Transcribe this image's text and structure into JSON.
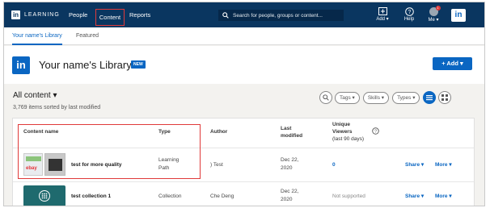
{
  "topbar": {
    "logo_text": "LEARNING",
    "logo_mark": "in",
    "nav": {
      "people": "People",
      "content": "Content",
      "reports": "Reports"
    },
    "search_placeholder": "Search for people, groups or content...",
    "add_label": "Add",
    "help_label": "Help",
    "me_label": "Me",
    "notification_count": "1",
    "linkedin_badge": "in",
    "colors": {
      "bar": "#0a3660",
      "highlight": "#e03a3a"
    }
  },
  "subnav": {
    "tab_library": "Your name's Library",
    "tab_featured": "Featured"
  },
  "library": {
    "mark": "in",
    "title": "Your name's Library",
    "badge": "NEW",
    "add_button": "+ Add"
  },
  "list": {
    "heading": "All content",
    "count": "3,769 items sorted by last modified",
    "filters": [
      "Tags",
      "Skills",
      "Types"
    ]
  },
  "table": {
    "headers": {
      "name": "Content name",
      "type": "Type",
      "author": "Author",
      "modified_1": "Last",
      "modified_2": "modified",
      "viewers_1": "Unique",
      "viewers_2": "Viewers",
      "viewers_3": "(last 90 days)"
    },
    "rows": [
      {
        "title": "test for more quality",
        "type_1": "Learning",
        "type_2": "Path",
        "author": ") Test",
        "date_1": "Dec 22,",
        "date_2": "2020",
        "viewers": "0",
        "share": "Share",
        "more": "More"
      },
      {
        "title": "test collection 1",
        "type_1": "Collection",
        "type_2": "",
        "author": "Che Deng",
        "date_1": "Dec 22,",
        "date_2": "2020",
        "viewers": "Not supported",
        "share": "Share",
        "more": "More"
      }
    ]
  },
  "thumb_text": "ebay"
}
